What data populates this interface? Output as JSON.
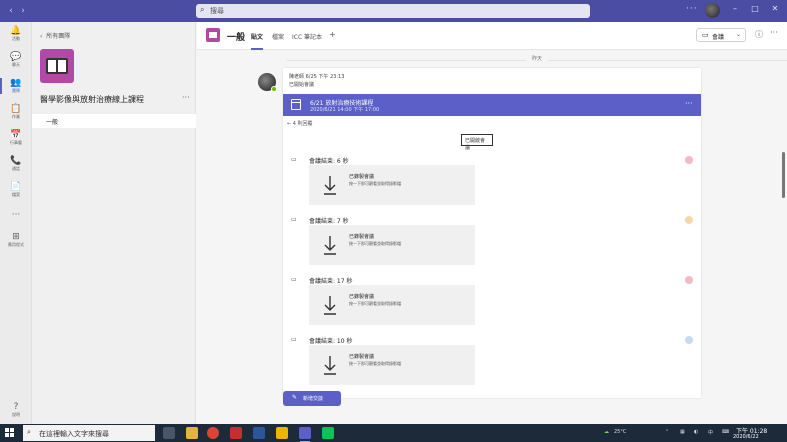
{
  "topbar": {
    "search_placeholder": "搜尋",
    "more": "···"
  },
  "rail": [
    {
      "label": "活動",
      "icon": "bell-icon",
      "glyph": "🔔"
    },
    {
      "label": "聊天",
      "icon": "chat-icon",
      "glyph": "💬"
    },
    {
      "label": "團隊",
      "icon": "teams-icon",
      "glyph": "👥"
    },
    {
      "label": "作業",
      "icon": "assignments-icon",
      "glyph": "📋"
    },
    {
      "label": "行事曆",
      "icon": "calendar-icon",
      "glyph": "📅"
    },
    {
      "label": "通話",
      "icon": "phone-icon",
      "glyph": "📞"
    },
    {
      "label": "檔案",
      "icon": "files-icon",
      "glyph": "📄"
    },
    {
      "label": "",
      "icon": "more-icon",
      "glyph": "···"
    },
    {
      "label": "應用程式",
      "icon": "apps-icon",
      "glyph": "⊞"
    },
    {
      "label": "說明",
      "icon": "help-icon",
      "glyph": "?"
    }
  ],
  "panel": {
    "back_label": "所有團隊",
    "team_name": "醫學影像與放射治療線上課程",
    "more": "···",
    "channel": "一般"
  },
  "header": {
    "channel_title": "一般",
    "tabs": [
      "貼文",
      "檔案",
      "ICC 筆記本",
      "+"
    ],
    "meet_label": "會議",
    "info": "ⓘ",
    "more": "···"
  },
  "date_divider": "昨天",
  "post": {
    "meta": "陳老師  6/25 下午 23:13",
    "subtitle": "已開始會議",
    "meeting_title": "6/21 放射治療技術課程",
    "meeting_time": "2020/6/21 14:00 下午 17:00",
    "replies": "← 4 則回覆",
    "tooltip": "已開啟會議",
    "more": "···"
  },
  "entries": [
    {
      "title": "會議結束: 6 秒",
      "card_title": "已錄製會議",
      "card_sub": "按一下即可觀看並取得錄影檔",
      "dot": "#f4b8c4"
    },
    {
      "title": "會議結束: 7 秒",
      "card_title": "已錄製會議",
      "card_sub": "按一下即可觀看並取得錄影檔",
      "dot": "#f7d7a8"
    },
    {
      "title": "會議結束: 17 秒",
      "card_title": "已錄製會議",
      "card_sub": "按一下即可觀看並取得錄影檔",
      "dot": "#f4b8c4"
    },
    {
      "title": "會議結束: 10 秒",
      "card_title": "已錄製會議",
      "card_sub": "按一下即可觀看並取得錄影檔",
      "dot": "#c7d8f0"
    }
  ],
  "new_conversation": "新增交談",
  "taskbar": {
    "search_text": "在這裡輸入文字來搜尋",
    "temperature": "25°C",
    "clock_time": "下午 01:28",
    "clock_date": "2020/6/22"
  },
  "colors": {
    "brand": "#5b5fc7",
    "topbar": "#4b4da3",
    "team": "#b04aa6"
  }
}
